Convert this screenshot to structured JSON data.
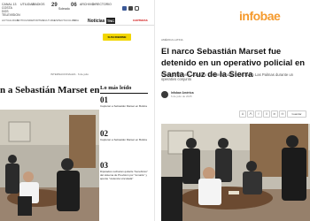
{
  "left": {
    "topbar": {
      "brand": "CANAL 13 COSTA\nDOS TELEVISION",
      "items": [
        "UTILIDAD",
        "RADIOS",
        "ARCHIVO",
        "DIRECTORIO"
      ],
      "temp": "29",
      "day": "06",
      "weather": "Soleado"
    },
    "nav": {
      "items": [
        "ACTUALIDAD",
        "NOTICIAS",
        "DEPORTES",
        "CULTURA",
        "ESPECTACULOS",
        "VIDA"
      ],
      "brand_prefix": "Noticias",
      "brand_badge": "TNC",
      "brand_tag": "CARTERAS"
    },
    "subscribe_label": "SUSCRIBIRME",
    "section_tag": "INTERNACIONALES · 6 de julio",
    "headline": "n a Sebastián Marset en",
    "most_read": {
      "title": "Lo más leído",
      "items": [
        {
          "num": "01",
          "text": "Capturan a Sebastián Marset en Bolivia"
        },
        {
          "num": "02",
          "text": "Capturan a Sebastián Marset en Bolivia"
        },
        {
          "num": "03",
          "text": "Diputados rechazan quitarle \"beneficios\" del sistema de Previsión por \"tomarle\" y apunte \"violencia vinculada\""
        }
      ]
    }
  },
  "right": {
    "logo": "infobae",
    "breadcrumb": "AMÉRICA LATINA",
    "headline": "El narco Sebastián Marset fue detenido en un operativo policial en Santa Cruz de la Sierra",
    "deck": "El narcotraficante uruguayo fue aprehendido en el barrio Las Palmas durante un operativo conjunto",
    "author": "Infobae América",
    "date": "6 de julio de 2025",
    "tools": [
      "A",
      "A",
      "f",
      "X",
      "in",
      "✉"
    ],
    "save_label": "Guardar"
  }
}
